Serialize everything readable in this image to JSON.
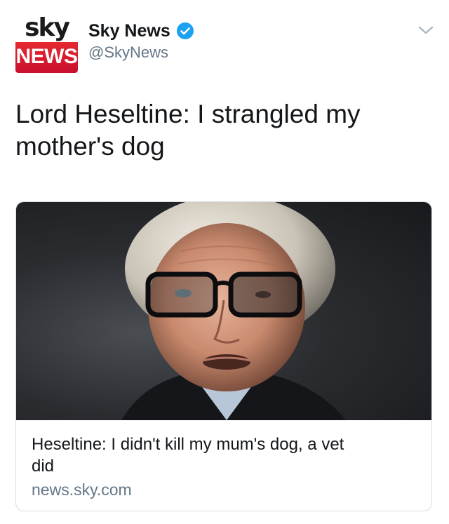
{
  "tweet": {
    "avatar": {
      "logo_top": "sky",
      "logo_bottom": "NEWS"
    },
    "display_name": "Sky News",
    "verified": true,
    "handle": "@SkyNews",
    "text_line1": "Lord Heseltine: I strangled my",
    "text_line2": "mother's dog"
  },
  "card": {
    "image_icon": "portrait-photo",
    "title_line1": "Heseltine: I didn't kill my mum's dog, a vet",
    "title_line2": "did",
    "domain": "news.sky.com"
  },
  "colors": {
    "text_primary": "#14171a",
    "text_secondary": "#657786",
    "verified_blue": "#1da1f2",
    "sky_red": "#d81f2a",
    "card_border": "#d8dee3"
  },
  "icons": {
    "verified": "verified-badge-icon",
    "menu": "chevron-down-icon"
  }
}
